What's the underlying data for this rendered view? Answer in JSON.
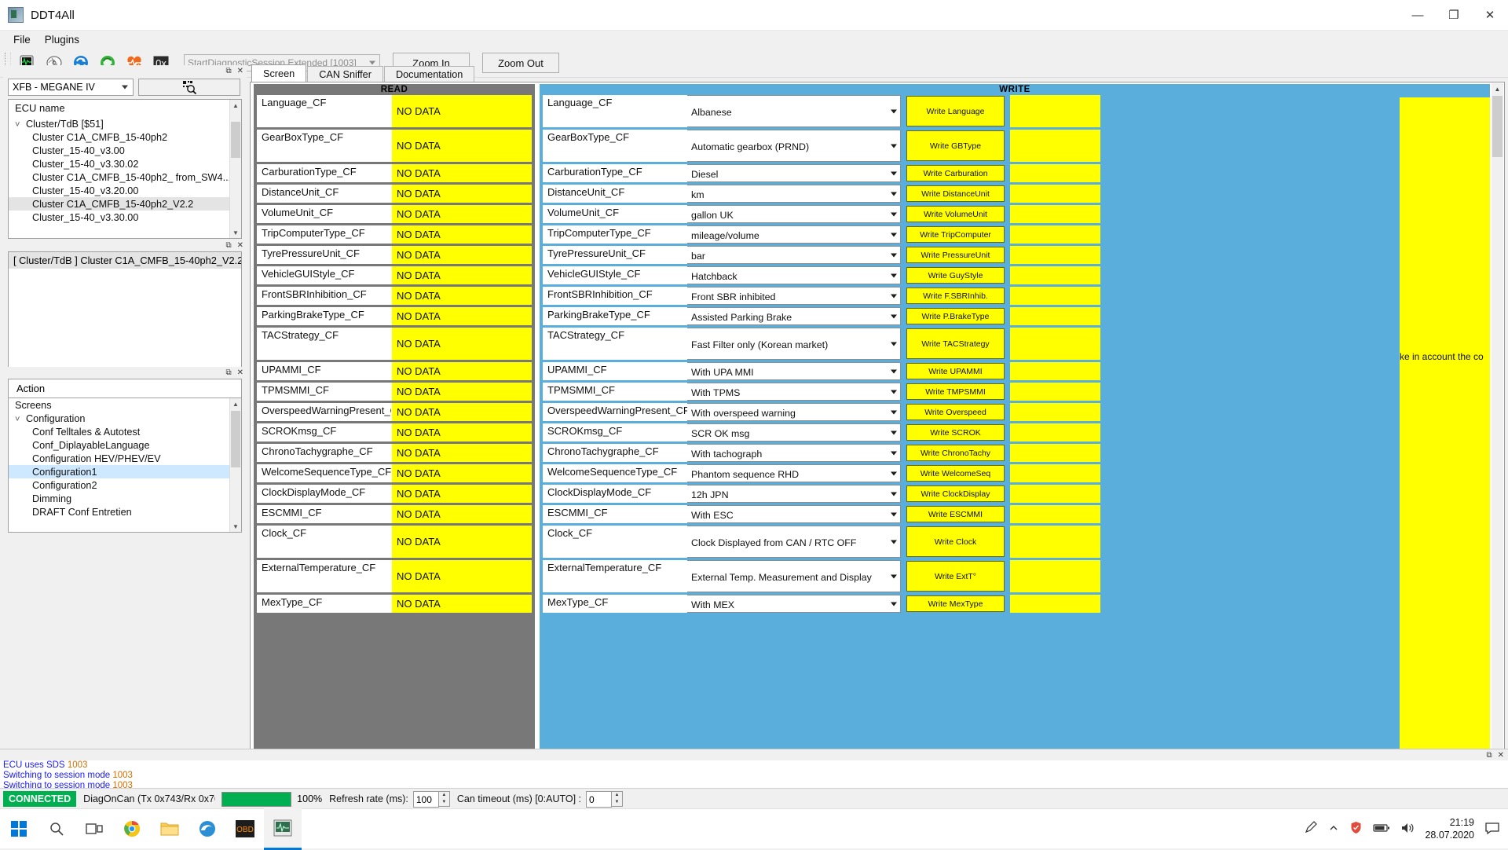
{
  "window": {
    "title": "DDT4All",
    "icon": "app-icon",
    "minimize": "—",
    "maximize": "❐",
    "close": "✕"
  },
  "menu": {
    "items": [
      "File",
      "Plugins"
    ]
  },
  "toolbar": {
    "icons": [
      "ecu-screen-icon",
      "ecu-brain-icon",
      "refresh-blue-icon",
      "refresh-green-icon",
      "heartbeat-icon",
      "hex-0x-icon"
    ],
    "session_combo": {
      "value": "StartDiagnosticSession.Extended [1003]",
      "arrow": "chevron-down-icon"
    },
    "zoom_in": "Zoom In",
    "zoom_out": "Zoom Out"
  },
  "sidebar": {
    "ecu_panel": {
      "vehicle_combo": "XFB - MEGANE IV",
      "search_icon": "qr-search-icon",
      "header": "ECU name",
      "tree_root": {
        "label": "Cluster/TdB [$51]",
        "expanded": true
      },
      "items": [
        {
          "label": "Cluster C1A_CMFB_15-40ph2",
          "selected": false
        },
        {
          "label": "Cluster_15-40_v3.00",
          "selected": false
        },
        {
          "label": "Cluster_15-40_v3.30.02",
          "selected": false
        },
        {
          "label": "Cluster C1A_CMFB_15-40ph2_ from_SW4...",
          "selected": false
        },
        {
          "label": "Cluster_15-40_v3.20.00",
          "selected": false
        },
        {
          "label": "Cluster C1A_CMFB_15-40ph2_V2.2",
          "selected": true
        },
        {
          "label": "Cluster_15-40_v3.30.00",
          "selected": false
        }
      ]
    },
    "selection_panel": {
      "title": "[ Cluster/TdB ] Cluster C1A_CMFB_15-40ph2_V2.2"
    },
    "action_panel": {
      "header": "Action",
      "root": "Screens",
      "group": {
        "label": "Configuration",
        "expanded": true
      },
      "items": [
        {
          "label": "Conf Telltales & Autotest",
          "selected": false
        },
        {
          "label": "Conf_DiplayableLanguage",
          "selected": false
        },
        {
          "label": "Configuration HEV/PHEV/EV",
          "selected": false
        },
        {
          "label": "Configuration1",
          "selected": true
        },
        {
          "label": "Configuration2",
          "selected": false
        },
        {
          "label": "Dimming",
          "selected": false
        },
        {
          "label": "DRAFT Conf Entretien",
          "selected": false
        }
      ]
    }
  },
  "tabs": [
    {
      "label": "Screen",
      "active": true
    },
    {
      "label": "CAN Sniffer",
      "active": false
    },
    {
      "label": "Documentation",
      "active": false
    }
  ],
  "screen": {
    "read_header": "READ",
    "write_header": "WRITE",
    "no_data_text": "NO DATA",
    "yellow_note": "ke in account the co",
    "rows": [
      {
        "name": "Language_CF",
        "read": "NO DATA",
        "value": "Albanese",
        "button": "Write Language",
        "tall": true
      },
      {
        "name": "GearBoxType_CF",
        "read": "NO DATA",
        "value": "Automatic gearbox (PRND)",
        "button": "Write GBType",
        "tall": true
      },
      {
        "name": "CarburationType_CF",
        "read": "NO DATA",
        "value": "Diesel",
        "button": "Write Carburation",
        "tall": false
      },
      {
        "name": "DistanceUnit_CF",
        "read": "NO DATA",
        "value": "km",
        "button": "Write DistanceUnit",
        "tall": false
      },
      {
        "name": "VolumeUnit_CF",
        "read": "NO DATA",
        "value": "gallon UK",
        "button": "Write VolumeUnit",
        "tall": false
      },
      {
        "name": "TripComputerType_CF",
        "read": "NO DATA",
        "value": "mileage/volume",
        "button": "Write TripComputer",
        "tall": false
      },
      {
        "name": "TyrePressureUnit_CF",
        "read": "NO DATA",
        "value": "bar",
        "button": "Write PressureUnit",
        "tall": false
      },
      {
        "name": "VehicleGUIStyle_CF",
        "read": "NO DATA",
        "value": "Hatchback",
        "button": "Write GuyStyle",
        "tall": false
      },
      {
        "name": "FrontSBRInhibition_CF",
        "read": "NO DATA",
        "value": "Front SBR inhibited",
        "button": "Write F.SBRInhib.",
        "tall": false
      },
      {
        "name": "ParkingBrakeType_CF",
        "read": "NO DATA",
        "value": "Assisted Parking Brake",
        "button": "Write P.BrakeType",
        "tall": false
      },
      {
        "name": "TACStrategy_CF",
        "read": "NO DATA",
        "value": "Fast Filter only (Korean market)",
        "button": "Write TACStrategy",
        "tall": true
      },
      {
        "name": "UPAMMI_CF",
        "read": "NO DATA",
        "value": "With UPA MMI",
        "button": "Write UPAMMI",
        "tall": false
      },
      {
        "name": "TPMSMMI_CF",
        "read": "NO DATA",
        "value": "With TPMS",
        "button": "Write TMPSMMI",
        "tall": false
      },
      {
        "name": "OverspeedWarningPresent_CF",
        "read": "NO DATA",
        "value": "With overspeed warning",
        "button": "Write Overspeed",
        "tall": false
      },
      {
        "name": "SCROKmsg_CF",
        "read": "NO DATA",
        "value": "SCR OK msg",
        "button": "Write SCROK",
        "tall": false
      },
      {
        "name": "ChronoTachygraphe_CF",
        "read": "NO DATA",
        "value": "With tachograph",
        "button": "Write ChronoTachy",
        "tall": false
      },
      {
        "name": "WelcomeSequenceType_CF",
        "read": "NO DATA",
        "value": "Phantom sequence  RHD",
        "button": "Write WelcomeSeq",
        "tall": false
      },
      {
        "name": "ClockDisplayMode_CF",
        "read": "NO DATA",
        "value": "12h JPN",
        "button": "Write ClockDisplay",
        "tall": false
      },
      {
        "name": "ESCMMI_CF",
        "read": "NO DATA",
        "value": "With ESC",
        "button": "Write ESCMMI",
        "tall": false
      },
      {
        "name": "Clock_CF",
        "read": "NO DATA",
        "value": "Clock Displayed from CAN / RTC OFF",
        "button": "Write Clock",
        "tall": true
      },
      {
        "name": "ExternalTemperature_CF",
        "read": "NO DATA",
        "value": "External Temp. Measurement and Display",
        "button": "Write ExtT°",
        "tall": true
      },
      {
        "name": "MexType_CF",
        "read": "NO DATA",
        "value": "With MEX",
        "button": "Write MexType",
        "tall": false
      }
    ]
  },
  "log": {
    "lines": [
      {
        "text": "ECU uses SDS ",
        "num": "1003"
      },
      {
        "text": "Switching to session mode ",
        "num": "1003"
      },
      {
        "text": "Switching to session mode ",
        "num": "1003"
      }
    ]
  },
  "status": {
    "connected": "CONNECTED",
    "device": "DiagOnCan (Tx 0x743/Rx 0x76",
    "progress_percent": "100%",
    "refresh_label": "Refresh rate (ms):",
    "refresh_value": "100",
    "timeout_label": "Can timeout (ms) [0:AUTO] :",
    "timeout_value": "0"
  },
  "taskbar": {
    "icons": [
      "start-windows-icon",
      "search-icon",
      "task-view-icon",
      "chrome-icon",
      "file-explorer-icon",
      "edge-icon",
      "obd-app-icon",
      "ddt4all-icon"
    ],
    "tray_icons": [
      "pen-icon",
      "chevron-up-icon",
      "shield-icon",
      "battery-icon",
      "volume-icon"
    ],
    "time": "21:19",
    "date": "28.07.2020",
    "notification_icon": "notification-icon"
  },
  "colors": {
    "yellow": "#ffff00",
    "write_blue": "#5aaedc",
    "read_grey": "#787878",
    "connected_green": "#00b050",
    "selection_blue": "#cde8ff"
  }
}
